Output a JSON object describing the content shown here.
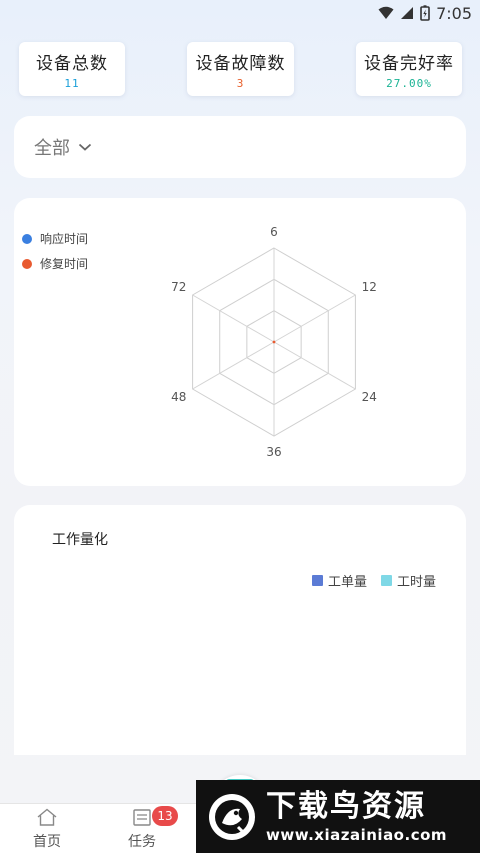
{
  "status_bar": {
    "time": "7:05"
  },
  "stats": [
    {
      "label": "设备总数",
      "value": "11",
      "color": "#1a9fd9"
    },
    {
      "label": "设备故障数",
      "value": "3",
      "color": "#e8602c"
    },
    {
      "label": "设备完好率",
      "value": "27.00%",
      "color": "#1ab394"
    }
  ],
  "filter": {
    "selected": "全部"
  },
  "radar": {
    "legend": [
      {
        "name": "响应时间",
        "color": "#3a7fe0"
      },
      {
        "name": "修复时间",
        "color": "#e85a30"
      }
    ],
    "axis_labels": [
      "6",
      "12",
      "24",
      "36",
      "48",
      "72"
    ]
  },
  "chart_data": {
    "type": "radar",
    "indicators": [
      "6",
      "12",
      "24",
      "36",
      "48",
      "72"
    ],
    "series": [
      {
        "name": "响应时间",
        "values": [
          0,
          0,
          0,
          0,
          0,
          0
        ]
      },
      {
        "name": "修复时间",
        "values": [
          0,
          0,
          0,
          0,
          0,
          0
        ]
      }
    ]
  },
  "work": {
    "title": "工作量化",
    "legend": [
      {
        "name": "工单量",
        "color": "#5b7bd5"
      },
      {
        "name": "工时量",
        "color": "#7fd8e6"
      }
    ]
  },
  "nav": {
    "home_label": "首页",
    "task_label": "任务",
    "task_badge": "13"
  },
  "watermark": {
    "title": "下载鸟资源",
    "url": "www.xiazainiao.com"
  }
}
